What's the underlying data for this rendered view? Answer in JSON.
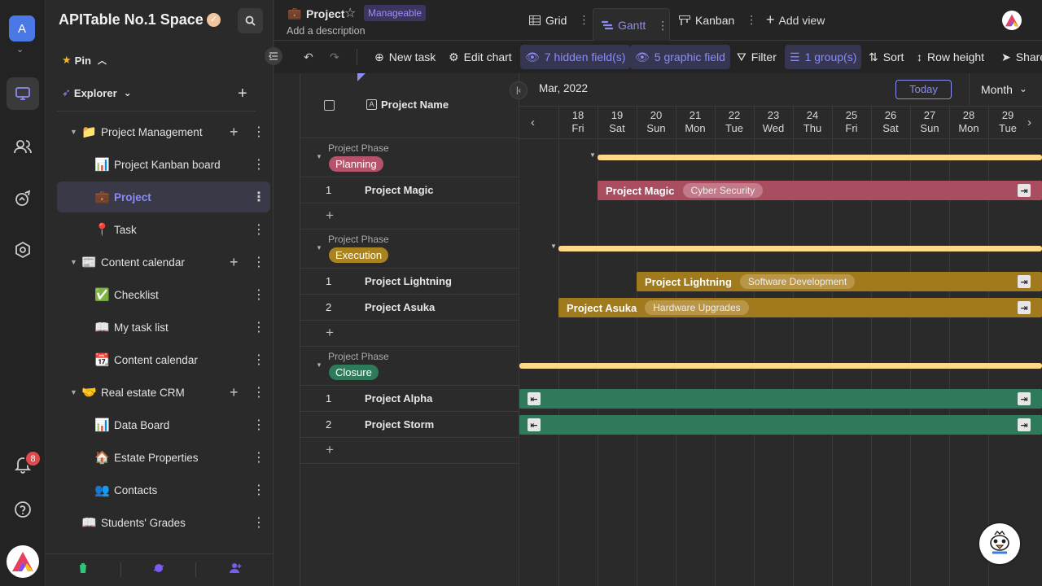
{
  "rail": {
    "space_initial": "A",
    "notif_count": "8"
  },
  "sidebar": {
    "space_title": "APITable No.1 Space",
    "pin_label": "Pin",
    "explorer_label": "Explorer",
    "tree": [
      {
        "label": "Project Management",
        "emoji": "📁",
        "level": 0,
        "folder": true
      },
      {
        "label": "Project Kanban board",
        "emoji": "📊",
        "level": 1
      },
      {
        "label": "Project",
        "emoji": "💼",
        "level": 1,
        "active": true
      },
      {
        "label": "Task",
        "emoji": "📍",
        "level": 1
      },
      {
        "label": "Content calendar",
        "emoji": "📰",
        "level": 0,
        "folder": true
      },
      {
        "label": "Checklist",
        "emoji": "✅",
        "level": 1
      },
      {
        "label": "My task list",
        "emoji": "📖",
        "level": 1
      },
      {
        "label": "Content calendar",
        "emoji": "📆",
        "level": 1
      },
      {
        "label": "Real estate CRM",
        "emoji": "🤝",
        "level": 0,
        "folder": true
      },
      {
        "label": "Data Board",
        "emoji": "📊",
        "level": 1
      },
      {
        "label": "Estate Properties",
        "emoji": "🏠",
        "level": 1
      },
      {
        "label": "Contacts",
        "emoji": "👥",
        "level": 1
      },
      {
        "label": "Students' Grades",
        "emoji": "📖",
        "level": 0
      }
    ]
  },
  "header": {
    "datasheet_title": "Project",
    "permission_badge": "Manageable",
    "description": "Add a description",
    "views": [
      "Grid",
      "Gantt",
      "Kanban"
    ],
    "add_view": "Add view"
  },
  "toolbar": {
    "new_task": "New task",
    "edit_chart": "Edit chart",
    "hidden_fields": "7 hidden field(s)",
    "graphic_field": "5 graphic field",
    "filter": "Filter",
    "groups": "1 group(s)",
    "sort": "Sort",
    "row_height": "Row height",
    "share": "Share"
  },
  "grid": {
    "name_header": "Project Name",
    "group_field_label": "Project Phase",
    "groups": [
      {
        "phase": "Planning",
        "color": "#b5536a",
        "rows": [
          {
            "num": "1",
            "name": "Project Magic"
          }
        ]
      },
      {
        "phase": "Execution",
        "color": "#a9831f",
        "rows": [
          {
            "num": "1",
            "name": "Project Lightning"
          },
          {
            "num": "2",
            "name": "Project Asuka"
          }
        ]
      },
      {
        "phase": "Closure",
        "color": "#2f7a5a",
        "rows": [
          {
            "num": "1",
            "name": "Project Alpha"
          },
          {
            "num": "2",
            "name": "Project Storm"
          }
        ]
      }
    ]
  },
  "gantt": {
    "month_label": "Mar, 2022",
    "today_label": "Today",
    "scale_label": "Month",
    "days": [
      {
        "d": "18",
        "w": "Fri"
      },
      {
        "d": "19",
        "w": "Sat"
      },
      {
        "d": "20",
        "w": "Sun"
      },
      {
        "d": "21",
        "w": "Mon"
      },
      {
        "d": "22",
        "w": "Tue"
      },
      {
        "d": "23",
        "w": "Wed"
      },
      {
        "d": "24",
        "w": "Thu"
      },
      {
        "d": "25",
        "w": "Fri"
      },
      {
        "d": "26",
        "w": "Sat"
      },
      {
        "d": "27",
        "w": "Sun"
      },
      {
        "d": "28",
        "w": "Mon"
      },
      {
        "d": "29",
        "w": "Tue"
      }
    ],
    "bars": [
      {
        "name": "Project Magic",
        "tag": "Cyber Security",
        "color": "#a94d60",
        "tagcolor": "#c27a8a"
      },
      {
        "name": "Project Lightning",
        "tag": "Software Development",
        "color": "#a07a1c",
        "tagcolor": "#b99547"
      },
      {
        "name": "Project Asuka",
        "tag": "Hardware Upgrades",
        "color": "#a07a1c",
        "tagcolor": "#b99547"
      },
      {
        "name": "",
        "tag": "",
        "color": "#2f7a5a"
      },
      {
        "name": "",
        "tag": "",
        "color": "#2f7a5a"
      }
    ]
  },
  "colors": {
    "accent": "#8b8cf5",
    "summary_bar": "#ffd88a"
  }
}
